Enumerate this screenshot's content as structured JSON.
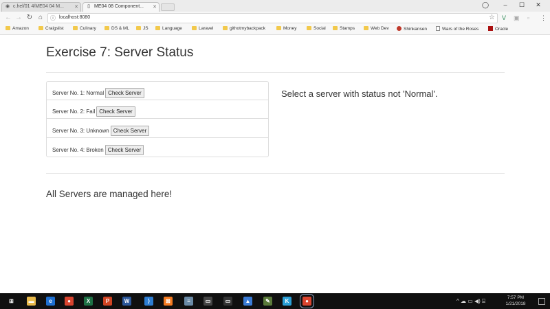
{
  "browser": {
    "tabs": [
      {
        "title": "c.hel/01 4/ME04 04 M...",
        "icon": "github-icon",
        "active": false
      },
      {
        "title": "ME04 08 Component...",
        "icon": "page-icon",
        "active": true
      }
    ],
    "address": "localhost:8080",
    "window_controls": {
      "profile": "◯",
      "minimize": "–",
      "restore": "☐",
      "close": "✕"
    },
    "bookmarks": [
      {
        "label": "Amazon",
        "icon": "folder-icon"
      },
      {
        "label": "Craigslist",
        "icon": "folder-icon"
      },
      {
        "label": "Culinary",
        "icon": "folder-icon"
      },
      {
        "label": "DS & ML",
        "icon": "folder-icon"
      },
      {
        "label": "JS",
        "icon": "folder-icon"
      },
      {
        "label": "Language",
        "icon": "folder-icon"
      },
      {
        "label": "Laravel",
        "icon": "folder-icon"
      },
      {
        "label": "githotmybackpack",
        "icon": "folder-icon"
      },
      {
        "label": "Money",
        "icon": "folder-icon"
      },
      {
        "label": "Social",
        "icon": "folder-icon"
      },
      {
        "label": "Stamps",
        "icon": "folder-icon"
      },
      {
        "label": "Web Dev",
        "icon": "folder-icon"
      },
      {
        "label": "Shinkansen",
        "icon": "record-icon"
      },
      {
        "label": "Wars of the Roses",
        "icon": "page-icon"
      },
      {
        "label": "Oracle",
        "icon": "oracle-icon"
      }
    ]
  },
  "page": {
    "title": "Exercise 7: Server Status",
    "servers": [
      {
        "label": "Server No. 1: Normal",
        "button": "Check Server"
      },
      {
        "label": "Server No. 2: Fail",
        "button": "Check Server"
      },
      {
        "label": "Server No. 3: Unknown",
        "button": "Check Server"
      },
      {
        "label": "Server No. 4: Broken",
        "button": "Check Server"
      }
    ],
    "status_message": "Select a server with status not 'Normal'.",
    "footer": "All Servers are managed here!"
  },
  "taskbar": {
    "apps": [
      {
        "name": "windows-start-icon",
        "glyph": "⊞",
        "color": "#101010"
      },
      {
        "name": "search-icon",
        "glyph": "⌕",
        "color": "#101010"
      },
      {
        "name": "file-explorer-icon",
        "glyph": "▬",
        "color": "#e8b94a"
      },
      {
        "name": "edge-icon",
        "glyph": "e",
        "color": "#1e6fd0"
      },
      {
        "name": "chrome-icon",
        "glyph": "●",
        "color": "#d9442f"
      },
      {
        "name": "excel-icon",
        "glyph": "X",
        "color": "#1e7145"
      },
      {
        "name": "powerpoint-icon",
        "glyph": "P",
        "color": "#d04423"
      },
      {
        "name": "word-icon",
        "glyph": "W",
        "color": "#2b579a"
      },
      {
        "name": "vscode-icon",
        "glyph": "⟩",
        "color": "#2d7dd2"
      },
      {
        "name": "xampp-icon",
        "glyph": "⊠",
        "color": "#f47a20"
      },
      {
        "name": "notepad-icon",
        "glyph": "≡",
        "color": "#6a8aa6"
      },
      {
        "name": "terminal-icon",
        "glyph": "▭",
        "color": "#444444"
      },
      {
        "name": "terminal-icon-2",
        "glyph": "▭",
        "color": "#333333"
      },
      {
        "name": "photos-icon",
        "glyph": "▲",
        "color": "#3a7bd5"
      },
      {
        "name": "tool-icon",
        "glyph": "✎",
        "color": "#5a7a3a"
      },
      {
        "name": "app-k-icon",
        "glyph": "K",
        "color": "#2a9fd6"
      },
      {
        "name": "chrome-active-icon",
        "glyph": "●",
        "color": "#d9442f"
      }
    ],
    "tray_icons": [
      "^",
      "☁",
      "▭",
      "◀)",
      "⌸"
    ],
    "time": "7:57 PM",
    "date": "1/21/2018"
  }
}
